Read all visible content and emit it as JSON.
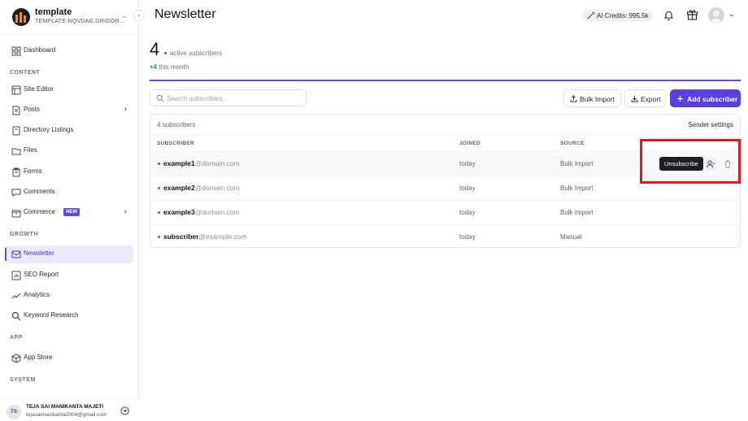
{
  "workspace": {
    "name": "template",
    "subtitle": "TEMPLATE-NQVDAG.GRIGOR..."
  },
  "sidebar": {
    "items": [
      {
        "label": "Dashboard",
        "icon": "grid-icon"
      },
      {
        "label": "Site Editor",
        "icon": "layout-icon"
      },
      {
        "label": "Posts",
        "icon": "document-icon"
      },
      {
        "label": "Directory Listings",
        "icon": "list-icon"
      },
      {
        "label": "Files",
        "icon": "folder-icon"
      },
      {
        "label": "Forms",
        "icon": "clipboard-icon"
      },
      {
        "label": "Comments",
        "icon": "comment-icon"
      },
      {
        "label": "Commerce",
        "icon": "box-icon",
        "badge": "NEW"
      },
      {
        "label": "Newsletter",
        "icon": "mail-icon"
      },
      {
        "label": "SEO Report",
        "icon": "report-icon"
      },
      {
        "label": "Analytics",
        "icon": "chart-icon"
      },
      {
        "label": "Keyword Research",
        "icon": "search-icon"
      },
      {
        "label": "App Store",
        "icon": "package-icon"
      }
    ],
    "sections": {
      "content": "CONTENT",
      "growth": "GROWTH",
      "app": "APP",
      "system": "SYSTEM"
    }
  },
  "user": {
    "initials": "TS",
    "name": "TEJA SAI MANIKANTA MAJETI",
    "email": "tejasaimanikanta2004@gmail.com"
  },
  "header": {
    "title": "Newsletter",
    "credits": "AI Credits: 995.5k"
  },
  "stats": {
    "count": "4",
    "label": "active subscribers",
    "delta": "+4",
    "delta_label": "this month"
  },
  "toolbar": {
    "search_placeholder": "Search subscribers...",
    "bulk_import": "Bulk Import",
    "export": "Export",
    "add": "Add subscriber"
  },
  "table": {
    "count_label": "4 subscribers",
    "sender_settings": "Sender settings",
    "headers": {
      "subscriber": "SUBSCRIBER",
      "joined": "JOINED",
      "source": "SOURCE"
    },
    "rows": [
      {
        "local": "example1",
        "domain": "@domain.com",
        "joined": "today",
        "source": "Bulk Import"
      },
      {
        "local": "example2",
        "domain": "@domain.com",
        "joined": "today",
        "source": "Bulk Import"
      },
      {
        "local": "example3",
        "domain": "@domain.com",
        "joined": "today",
        "source": "Bulk Import"
      },
      {
        "local": "subscriber",
        "domain": "@example.com",
        "joined": "today",
        "source": "Manual"
      }
    ],
    "tooltip": "Unsubscribe"
  },
  "colors": {
    "accent": "#5b3ee0",
    "highlight": "#e0191d"
  }
}
